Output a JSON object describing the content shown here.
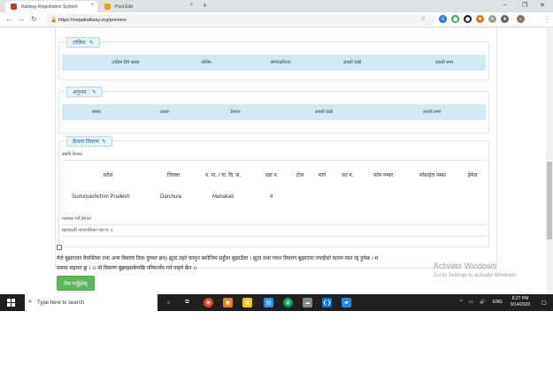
{
  "browser": {
    "tabs": [
      {
        "label": "Railway Registration System",
        "close": "×",
        "active": true,
        "color": "#c0392b"
      },
      {
        "label": "Post Edit",
        "close": "×",
        "active": false,
        "color": "#f39c12"
      }
    ],
    "new_tab": "+",
    "window_controls": {
      "minimize": "–",
      "maximize": "❐",
      "close": "✕"
    },
    "nav": {
      "back": "←",
      "forward": "→",
      "reload": "↻"
    },
    "url": "https://nepalrailway.org/preview",
    "lock": "🔒",
    "star": "☆",
    "menu": "⋮",
    "extensions": [
      {
        "glyph": "G",
        "color": "#1a73e8"
      },
      {
        "glyph": "⬤",
        "color": "#34a853"
      },
      {
        "glyph": "⬤",
        "color": "#1a1a1a"
      },
      {
        "glyph": "✱",
        "color": "#e8710a"
      },
      {
        "glyph": "✎",
        "color": "#9e9e9e"
      },
      {
        "glyph": "✚",
        "color": "#5f6368"
      },
      {
        "glyph": "◐",
        "color": "#8d6e63"
      }
    ]
  },
  "training": {
    "legend": "तालिम:",
    "edit_icon": "✎",
    "columns": [
      "तालिम दिने संस्था",
      "तालिम",
      "श्रेणी/प्रतिशत",
      "अवधी देखी",
      "अवधी सम्म"
    ]
  },
  "experience": {
    "legend": "अनुभव :",
    "edit_icon": "✎",
    "columns": [
      "संस्था",
      "प्रकार",
      "ठेगाना",
      "अवधी देखी",
      "अवधी सम्म"
    ]
  },
  "address": {
    "legend": "ठेगाना विवरण",
    "edit_icon": "✎",
    "permanent_label": "स्थायि ठेगाना",
    "columns": [
      "प्रदेश",
      "जिल्ला",
      "न. पा. / गा. वि. स.",
      "वडा न.",
      "टोल",
      "मार्ग",
      "घर न.",
      "फोन नम्बर",
      "मोबाईल नम्बर",
      "ईमेल"
    ],
    "row": {
      "province": "Sudurpashchim Pradesh",
      "district": "Darchula",
      "municipality": "Mahakali",
      "ward": "4"
    },
    "correspondence_label": "पत्राचार गर्ने ठेगाना",
    "correspondence_value": "महाकाली नगरपालिका वडा नं. ५"
  },
  "declaration": {
    "line1": "मैले बुझाएका वैयक्तिक तथा अन्य विवरण ठिक दुरुस्त छन्। झुठा ठहरे कानुन बमोजिम सहुँला बुझाउँला । झुठा तथा गलत विवरण बुझाएमा तपाईंको फारम स्वत रद्द हुनेछ । म",
    "line2": "यसमा सहमत छु । ।। यो विवरण बुझाइसकेपछि परिमार्जन गर्न पाइने छैन ।।"
  },
  "submit_label": "पेश गर्नुहोस्",
  "watermark": {
    "title": "Activate Windows",
    "subtitle": "Go to Settings to activate Windows."
  },
  "taskbar": {
    "search_placeholder": "Type here to search",
    "search_icon": "⌕",
    "apps": [
      {
        "glyph": "○",
        "color": "#202020"
      },
      {
        "glyph": "⧉",
        "color": "#202020"
      },
      {
        "glyph": "◉",
        "color": "#db4437"
      },
      {
        "glyph": "▣",
        "color": "#e67e22"
      },
      {
        "glyph": "▦",
        "color": "#f1c40f"
      },
      {
        "glyph": "▤",
        "color": "#2f8fe0"
      },
      {
        "glyph": "◍",
        "color": "#0f9d58"
      },
      {
        "glyph": "☁",
        "color": "#7f8c8d"
      },
      {
        "glyph": "❮❯",
        "color": "#0078d7"
      },
      {
        "glyph": "▰",
        "color": "#1e88e5"
      }
    ],
    "tray_up": "^",
    "tray_items": [
      "▭",
      "🔊"
    ],
    "language": "ENG",
    "time": "8:27 PM",
    "date": "9/14/2020"
  }
}
